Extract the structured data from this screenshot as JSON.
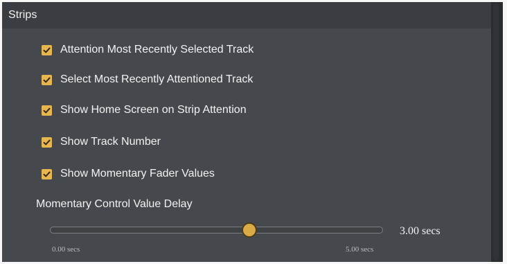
{
  "header": {
    "title": "Strips"
  },
  "options": [
    {
      "label": "Attention Most Recently Selected Track",
      "checked": true
    },
    {
      "label": "Select Most Recently Attentioned Track",
      "checked": true
    },
    {
      "label": "Show Home Screen on Strip Attention",
      "checked": true
    },
    {
      "label": "Show Track Number",
      "checked": true
    },
    {
      "label": "Show Momentary Fader Values",
      "checked": true
    }
  ],
  "momentary": {
    "label": "Momentary Control Value Delay",
    "value_text": "3.00 secs",
    "min_text": "0.00 secs",
    "max_text": "5.00 secs",
    "value": 3.0,
    "min": 0.0,
    "max": 5.0
  },
  "colors": {
    "accent": "#e8b64f",
    "panel_bg": "#45494d",
    "header_bg": "#3a3e42"
  }
}
